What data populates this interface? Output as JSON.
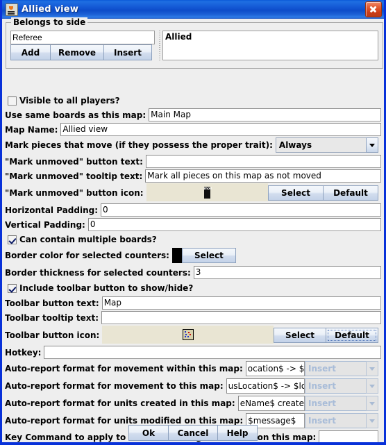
{
  "window": {
    "title": "Allied view",
    "icon": "java-coffee-cup-icon",
    "close_label": "Close"
  },
  "group": {
    "title": "Belongs to side",
    "side_input_value": "Referee",
    "buttons": {
      "add": "Add",
      "remove": "Remove",
      "insert": "Insert"
    },
    "list_items": [
      "Allied"
    ]
  },
  "fields": {
    "visible_to_all_label": "Visible to all players?",
    "visible_to_all_checked": false,
    "use_same_boards_label": "Use same boards as this map:",
    "use_same_boards_value": "Main Map",
    "map_name_label": "Map Name:",
    "map_name_value": "Allied view",
    "mark_pieces_label": "Mark pieces that move (if they possess the proper trait):",
    "mark_pieces_value": "Always",
    "mark_unmoved_button_text_label": "\"Mark unmoved\" button text:",
    "mark_unmoved_button_text_value": "",
    "mark_unmoved_tooltip_label": "\"Mark unmoved\" tooltip text:",
    "mark_unmoved_tooltip_value": "Mark all pieces on this map as not moved",
    "mark_unmoved_icon_label": "\"Mark unmoved\" button icon:",
    "mark_unmoved_icon_name": "mov-badge-icon",
    "mark_unmoved_icon_text": "mov",
    "select_label": "Select",
    "default_label": "Default",
    "horizontal_padding_label": "Horizontal Padding:",
    "horizontal_padding_value": "0",
    "vertical_padding_label": "Vertical Padding:",
    "vertical_padding_value": "0",
    "multiple_boards_label": "Can contain multiple boards?",
    "multiple_boards_checked": true,
    "border_color_label": "Border color for selected counters:",
    "border_color_value": "#000000",
    "border_thickness_label": "Border thickness for selected counters:",
    "border_thickness_value": "3",
    "include_toolbar_label": "Include toolbar button to show/hide?",
    "include_toolbar_checked": true,
    "toolbar_button_text_label": "Toolbar button text:",
    "toolbar_button_text_value": "Map",
    "toolbar_tooltip_label": "Toolbar tooltip text:",
    "toolbar_tooltip_value": "",
    "toolbar_icon_label": "Toolbar button icon:",
    "toolbar_icon_name": "map-counters-icon",
    "hotkey_label": "Hotkey:",
    "hotkey_value": "",
    "key_command_label": "Key Command to apply to all units ending movement on this map:",
    "key_command_value": ""
  },
  "auto_report": {
    "insert_label": "Insert",
    "rows": [
      {
        "label": "Auto-report format for movement within this map:",
        "value": "ocation$ -> $location$ *"
      },
      {
        "label": "Auto-report format for movement to this map:",
        "value": "usLocation$ -> $location$ *"
      },
      {
        "label": "Auto-report format for units created in this map:",
        "value": "eName$ created in $location$"
      },
      {
        "label": "Auto-report format for units modified on this map:",
        "value": "$message$"
      }
    ]
  },
  "footer": {
    "ok": "Ok",
    "cancel": "Cancel",
    "help": "Help"
  },
  "colors": {
    "titlebar_blue": "#0d4cc9",
    "window_border": "#0831d9",
    "panel_bg": "#eeeeee",
    "icon_panel_bg": "#e9e5d3"
  }
}
